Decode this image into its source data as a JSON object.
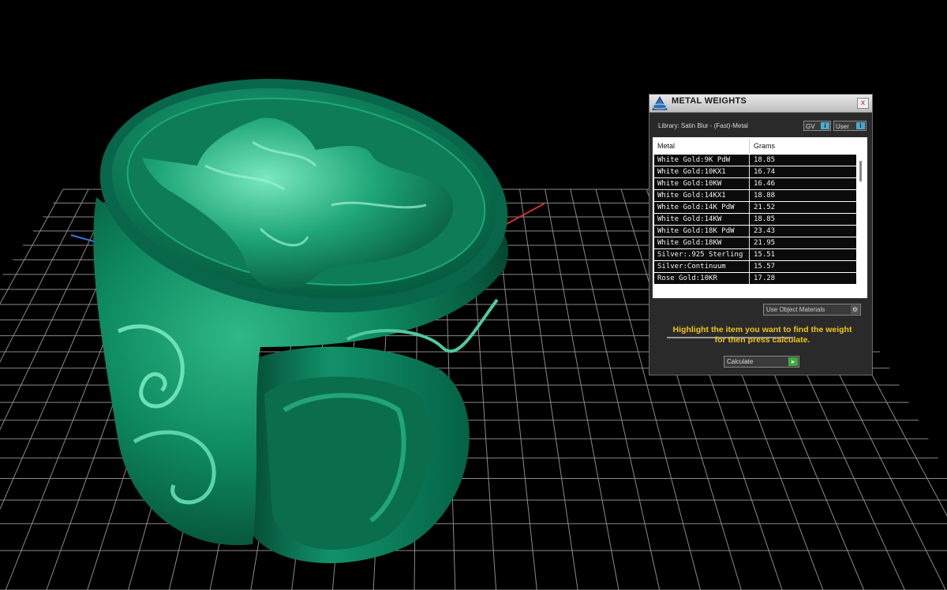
{
  "panel": {
    "title": "METAL WEIGHTS",
    "close_glyph": "x",
    "library_label": "Library: Satin Blur - (Fast)-Metal",
    "toggles": [
      {
        "label": "GV",
        "glyph": "i"
      },
      {
        "label": "User",
        "glyph": "i"
      }
    ],
    "columns": {
      "metal": "Metal",
      "grams": "Grams"
    },
    "rows": [
      {
        "metal": "White Gold:9K PdW",
        "grams": "18.85"
      },
      {
        "metal": "White Gold:10KX1",
        "grams": "16.74"
      },
      {
        "metal": "White Gold:10KW",
        "grams": "16.46"
      },
      {
        "metal": "White Gold:14KX1",
        "grams": "18.88"
      },
      {
        "metal": "White Gold:14K PdW",
        "grams": "21.52"
      },
      {
        "metal": "White Gold:14KW",
        "grams": "18.85"
      },
      {
        "metal": "White Gold:18K PdW",
        "grams": "23.43"
      },
      {
        "metal": "White Gold:18KW",
        "grams": "21.95"
      },
      {
        "metal": "Silver:.925 Sterling",
        "grams": "15.51"
      },
      {
        "metal": "Silver:Continuum",
        "grams": "15.57"
      },
      {
        "metal": "Rose Gold:10KR",
        "grams": "17.28"
      }
    ],
    "material_select": "Use Object Materials",
    "hint_line1": "Highlight the item you want to find the weight",
    "hint_line2": "for then press calculate.",
    "calculate_label": "Calculate",
    "calculate_glyph": "▸"
  },
  "colors": {
    "model": "#0f7a5a",
    "hint": "#f0c419",
    "grid": "#8a8a8a",
    "axis_x": "#d23030",
    "axis_y": "#3a7ad8"
  },
  "icons": {
    "panel_logo": "app-logo-icon",
    "close": "close-icon",
    "gear": "gear-icon",
    "go": "play-arrow-icon"
  }
}
